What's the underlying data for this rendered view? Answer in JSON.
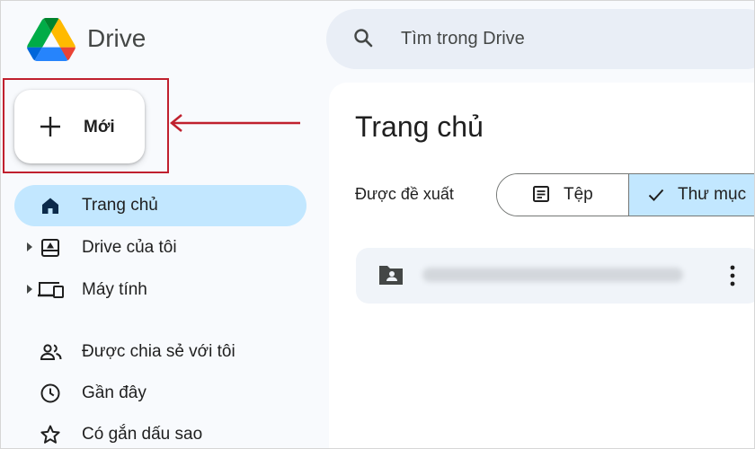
{
  "header": {
    "app_title": "Drive",
    "search_placeholder": "Tìm trong Drive"
  },
  "new_button": {
    "label": "Mới"
  },
  "sidebar": {
    "items": [
      {
        "label": "Trang chủ",
        "icon": "home-icon",
        "active": true
      },
      {
        "label": "Drive của tôi",
        "icon": "my-drive-icon",
        "expandable": true
      },
      {
        "label": "Máy tính",
        "icon": "computers-icon",
        "expandable": true
      },
      {
        "label": "Được chia sẻ với tôi",
        "icon": "shared-icon"
      },
      {
        "label": "Gần đây",
        "icon": "clock-icon"
      },
      {
        "label": "Có gắn dấu sao",
        "icon": "star-icon"
      }
    ]
  },
  "main": {
    "title": "Trang chủ",
    "suggested_label": "Được đề xuất",
    "filters": {
      "files_label": "Tệp",
      "folders_label": "Thư mục",
      "selected": "folders"
    }
  },
  "colors": {
    "active_bg": "#c2e7ff",
    "annotation_red": "#c0202e",
    "search_bg": "#e9eef6",
    "page_bg": "#f8fafd"
  }
}
